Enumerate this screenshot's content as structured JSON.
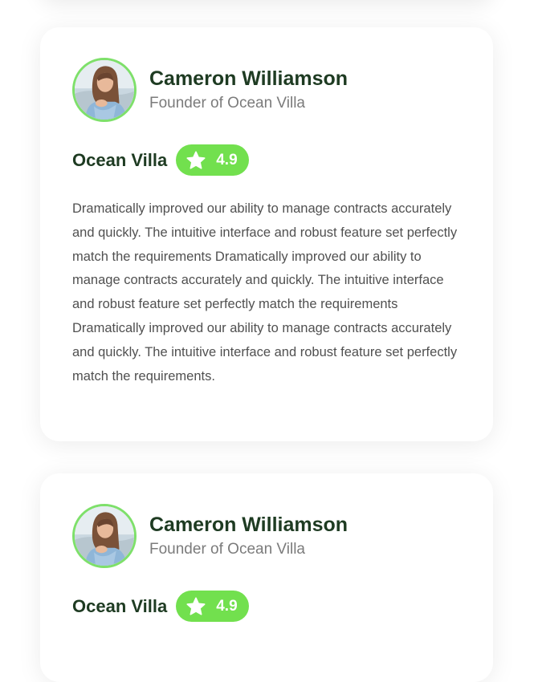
{
  "testimonials": [
    {
      "name": "Cameron Williamson",
      "role": "Founder of Ocean Villa",
      "company": "Ocean Villa",
      "rating": "4.9",
      "review": "Dramatically improved our ability to manage contracts accurately and quickly. The intuitive interface and robust feature set perfectly match the requirements  Dramatically improved our ability to manage contracts accurately and quickly. The intuitive interface and robust feature set perfectly match the requirements Dramatically improved our ability to manage contracts accurately and quickly. The intuitive interface and robust feature set perfectly match the requirements."
    },
    {
      "name": "Cameron Williamson",
      "role": "Founder of Ocean Villa",
      "company": "Ocean Villa",
      "rating": "4.9"
    }
  ],
  "colors": {
    "accent_green": "#72e04e",
    "heading_dark_green": "#1e3b22",
    "muted_gray": "#7b7b7b",
    "body_text": "#505050"
  },
  "icons": {
    "rating": "star-icon",
    "avatar": "avatar-photo"
  }
}
